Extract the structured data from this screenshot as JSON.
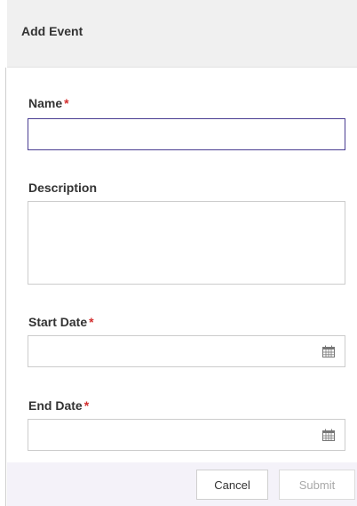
{
  "dialog": {
    "title": "Add Event"
  },
  "form": {
    "name": {
      "label": "Name",
      "required_marker": "*",
      "value": ""
    },
    "description": {
      "label": "Description",
      "value": ""
    },
    "start_date": {
      "label": "Start Date",
      "required_marker": "*",
      "value": "",
      "icon": "calendar-icon"
    },
    "end_date": {
      "label": "End Date",
      "required_marker": "*",
      "value": "",
      "icon": "calendar-icon"
    }
  },
  "footer": {
    "cancel_label": "Cancel",
    "submit_label": "Submit",
    "submit_disabled": true
  },
  "colors": {
    "required": "#d32f2f",
    "focus_border": "#4a3d92",
    "header_bg": "#f0f0f0",
    "footer_bg": "#f4f2f9",
    "disabled_text": "#a9a9a9"
  }
}
